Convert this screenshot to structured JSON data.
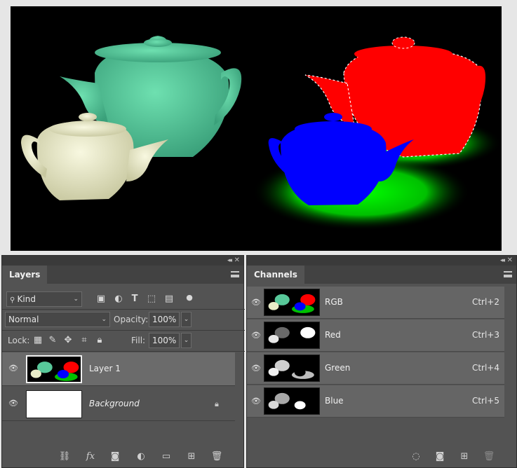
{
  "colors": {
    "panel_bg": "#535353",
    "row_selected": "#6b6b6b",
    "teapot_green": "#58c89a",
    "teapot_cream": "#e8ecc8",
    "mask_red": "#ff0000",
    "mask_blue": "#0000ff",
    "mask_green": "#00ff00"
  },
  "layers_panel": {
    "tab_label": "Layers",
    "filter": {
      "label": "Kind",
      "icon": "search-icon"
    },
    "blend_mode": "Normal",
    "opacity_label": "Opacity:",
    "opacity_value": "100%",
    "lock_label": "Lock:",
    "fill_label": "Fill:",
    "fill_value": "100%",
    "layers": [
      {
        "name": "Layer 1",
        "selected": true,
        "visible": true
      },
      {
        "name": "Background",
        "selected": false,
        "visible": true,
        "locked": true
      }
    ]
  },
  "channels_panel": {
    "tab_label": "Channels",
    "channels": [
      {
        "name": "RGB",
        "shortcut": "Ctrl+2"
      },
      {
        "name": "Red",
        "shortcut": "Ctrl+3"
      },
      {
        "name": "Green",
        "shortcut": "Ctrl+4"
      },
      {
        "name": "Blue",
        "shortcut": "Ctrl+5"
      }
    ]
  }
}
